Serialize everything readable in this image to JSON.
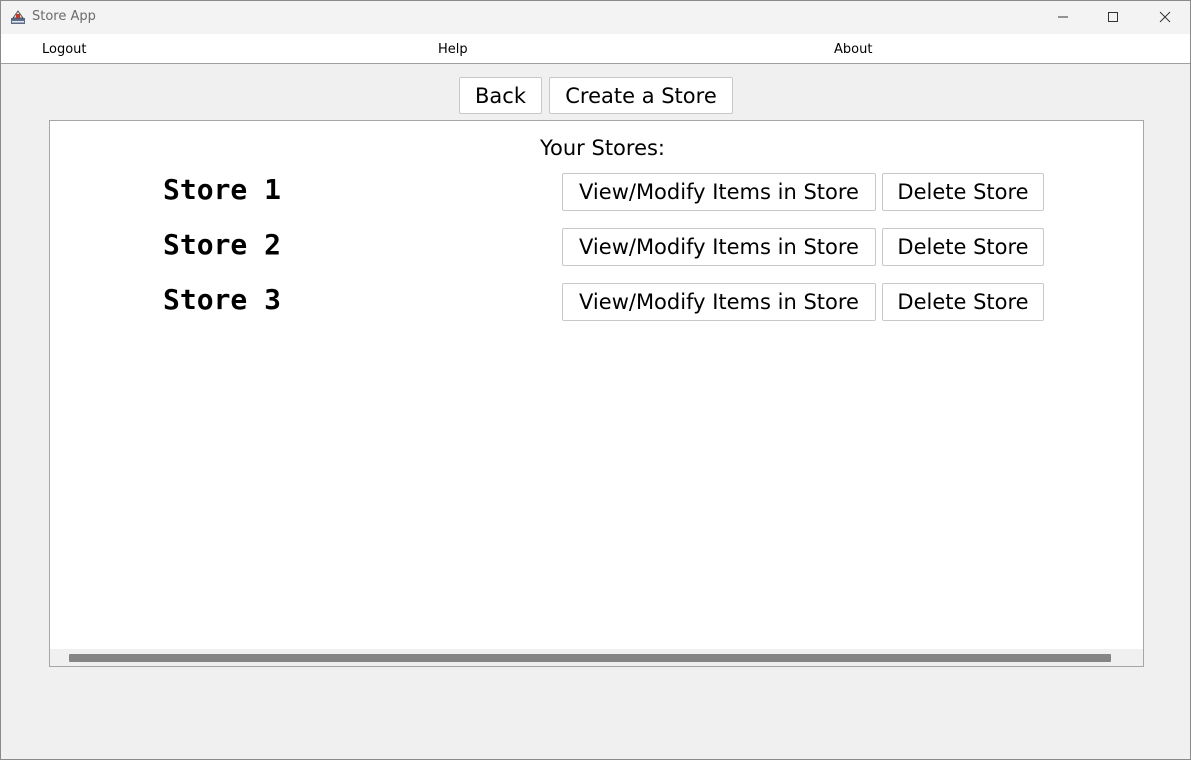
{
  "window": {
    "title": "Store App",
    "minimize_label": "Minimize",
    "maximize_label": "Maximize",
    "close_label": "Close"
  },
  "menu": {
    "items": [
      {
        "label": "Logout"
      },
      {
        "label": "Help"
      },
      {
        "label": "About"
      }
    ]
  },
  "toolbar": {
    "back_label": "Back",
    "create_label": "Create a Store"
  },
  "stores": {
    "heading": "Your Stores:",
    "view_label": "View/Modify Items in Store",
    "delete_label": "Delete Store",
    "items": [
      {
        "name": "Store 1"
      },
      {
        "name": "Store 2"
      },
      {
        "name": "Store 3"
      }
    ]
  },
  "icons": {
    "app": "java-app-icon",
    "minimize": "minimize-icon",
    "maximize": "maximize-icon",
    "close": "close-icon"
  }
}
